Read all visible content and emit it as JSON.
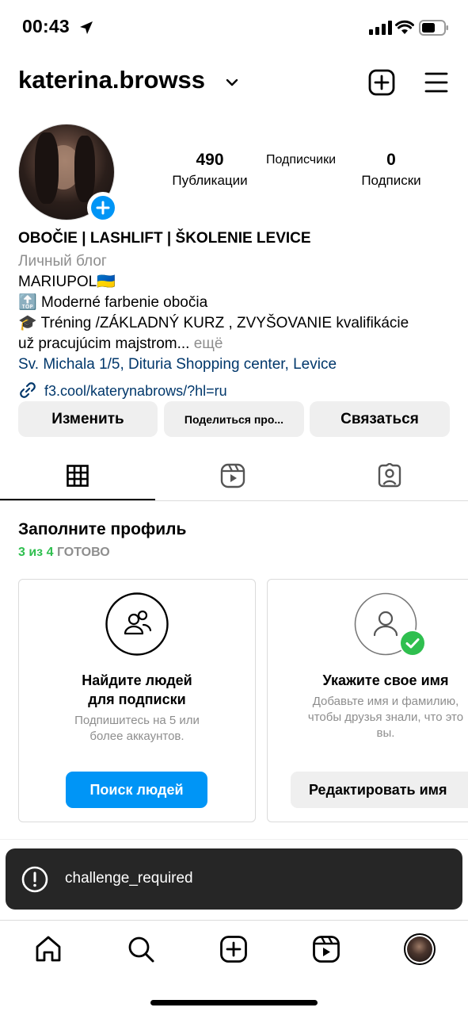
{
  "status": {
    "time": "00:43"
  },
  "header": {
    "username": "katerina.browss"
  },
  "stats": {
    "posts": {
      "value": "490",
      "label": "Публикации"
    },
    "followers": {
      "value": "",
      "label": "Подписчики"
    },
    "following": {
      "value": "0",
      "label": "Подписки"
    }
  },
  "bio": {
    "name": "OBOČIE | LASHLIFT | ŠKOLENIE LEVICE",
    "category": "Личный блог",
    "line1": "MARIUPOL",
    "line1_flag": "🇺🇦",
    "line2_icon": "🔝",
    "line2": "Moderné farbenie obočia",
    "line3_icon": "🎓",
    "line3": "Tréning /ZÁKLADNÝ KURZ , ZVYŠOVANIE kvalifikácie",
    "line4": "už pracujúcim majstrom...",
    "more": "ещё",
    "address": "Sv. Michala 1/5, Dituria Shopping center, Levice",
    "link": "f3.cool/katerynabrows/?hl=ru"
  },
  "buttons": {
    "edit": "Изменить",
    "share": "Поделиться про...",
    "contact": "Связаться"
  },
  "complete": {
    "title": "Заполните профиль",
    "progress": "3 из 4",
    "done": "ГОТОВО"
  },
  "cards": [
    {
      "title1": "Найдите людей",
      "title2": "для подписки",
      "sub1": "Подпишитесь на 5 или",
      "sub2": "более аккаунтов.",
      "button": "Поиск людей"
    },
    {
      "title1": "Укажите свое имя",
      "sub1": "Добавьте имя и фамилию,",
      "sub2": "чтобы друзья знали, что это",
      "sub3": "вы.",
      "button": "Редактировать имя"
    }
  ],
  "toast": {
    "text": "challenge_required"
  },
  "colors": {
    "accent": "#0095f6",
    "link": "#00376b",
    "success": "#2fbf4f",
    "toast_bg": "#262626"
  }
}
